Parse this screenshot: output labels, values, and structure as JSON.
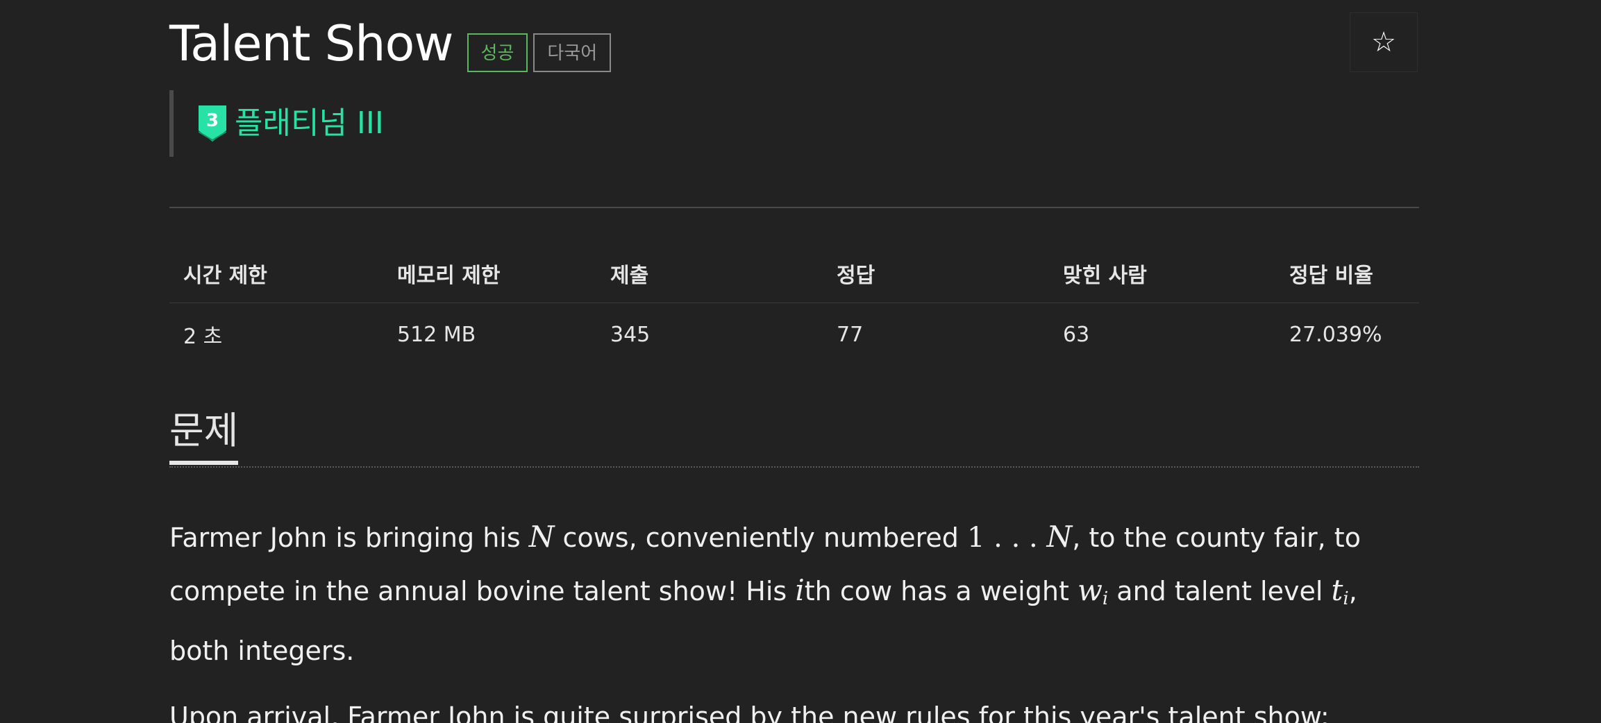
{
  "header": {
    "title": "Talent Show",
    "labels": {
      "success": "성공",
      "multilang": "다국어"
    },
    "star_icon": "☆"
  },
  "tier": {
    "badge_number": "3",
    "name": "플래티넘 III",
    "color": "#27e2a4",
    "badge_color": "#27e2a4"
  },
  "info_table": {
    "headers": [
      "시간 제한",
      "메모리 제한",
      "제출",
      "정답",
      "맞힌 사람",
      "정답 비율"
    ],
    "values": [
      "2 초",
      "512 MB",
      "345",
      "77",
      "63",
      "27.039%"
    ]
  },
  "section": {
    "title": "문제"
  },
  "problem": {
    "p1": {
      "t1": "Farmer John is bringing his ",
      "m1": "N",
      "t2": " cows, conveniently numbered ",
      "m2a": "1 . . . ",
      "m2b": "N",
      "t3": ", to the county fair, to compete in the annual bovine talent show! His ",
      "m3": "i",
      "t4": "th cow has a weight ",
      "m4": "w",
      "m4sub": "i",
      "t5": " and talent level ",
      "m5": "t",
      "m5sub": "i",
      "t6": ", both integers."
    },
    "p2": "Upon arrival, Farmer John is quite surprised by the new rules for this year's talent show:"
  }
}
